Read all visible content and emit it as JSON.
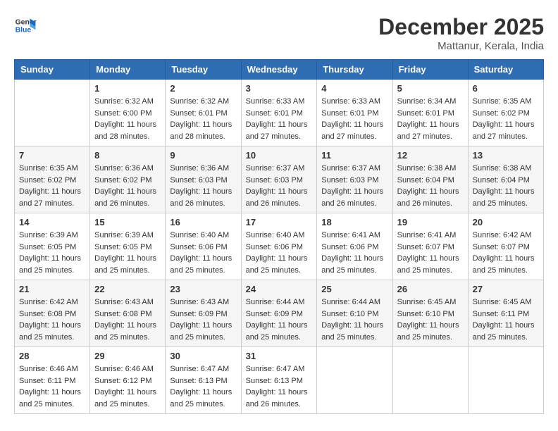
{
  "header": {
    "logo_line1": "General",
    "logo_line2": "Blue",
    "month_title": "December 2025",
    "location": "Mattanur, Kerala, India"
  },
  "weekdays": [
    "Sunday",
    "Monday",
    "Tuesday",
    "Wednesday",
    "Thursday",
    "Friday",
    "Saturday"
  ],
  "weeks": [
    [
      {
        "day": "",
        "info": ""
      },
      {
        "day": "1",
        "info": "Sunrise: 6:32 AM\nSunset: 6:00 PM\nDaylight: 11 hours and 28 minutes."
      },
      {
        "day": "2",
        "info": "Sunrise: 6:32 AM\nSunset: 6:01 PM\nDaylight: 11 hours and 28 minutes."
      },
      {
        "day": "3",
        "info": "Sunrise: 6:33 AM\nSunset: 6:01 PM\nDaylight: 11 hours and 27 minutes."
      },
      {
        "day": "4",
        "info": "Sunrise: 6:33 AM\nSunset: 6:01 PM\nDaylight: 11 hours and 27 minutes."
      },
      {
        "day": "5",
        "info": "Sunrise: 6:34 AM\nSunset: 6:01 PM\nDaylight: 11 hours and 27 minutes."
      },
      {
        "day": "6",
        "info": "Sunrise: 6:35 AM\nSunset: 6:02 PM\nDaylight: 11 hours and 27 minutes."
      }
    ],
    [
      {
        "day": "7",
        "info": "Sunrise: 6:35 AM\nSunset: 6:02 PM\nDaylight: 11 hours and 27 minutes."
      },
      {
        "day": "8",
        "info": "Sunrise: 6:36 AM\nSunset: 6:02 PM\nDaylight: 11 hours and 26 minutes."
      },
      {
        "day": "9",
        "info": "Sunrise: 6:36 AM\nSunset: 6:03 PM\nDaylight: 11 hours and 26 minutes."
      },
      {
        "day": "10",
        "info": "Sunrise: 6:37 AM\nSunset: 6:03 PM\nDaylight: 11 hours and 26 minutes."
      },
      {
        "day": "11",
        "info": "Sunrise: 6:37 AM\nSunset: 6:03 PM\nDaylight: 11 hours and 26 minutes."
      },
      {
        "day": "12",
        "info": "Sunrise: 6:38 AM\nSunset: 6:04 PM\nDaylight: 11 hours and 26 minutes."
      },
      {
        "day": "13",
        "info": "Sunrise: 6:38 AM\nSunset: 6:04 PM\nDaylight: 11 hours and 25 minutes."
      }
    ],
    [
      {
        "day": "14",
        "info": "Sunrise: 6:39 AM\nSunset: 6:05 PM\nDaylight: 11 hours and 25 minutes."
      },
      {
        "day": "15",
        "info": "Sunrise: 6:39 AM\nSunset: 6:05 PM\nDaylight: 11 hours and 25 minutes."
      },
      {
        "day": "16",
        "info": "Sunrise: 6:40 AM\nSunset: 6:06 PM\nDaylight: 11 hours and 25 minutes."
      },
      {
        "day": "17",
        "info": "Sunrise: 6:40 AM\nSunset: 6:06 PM\nDaylight: 11 hours and 25 minutes."
      },
      {
        "day": "18",
        "info": "Sunrise: 6:41 AM\nSunset: 6:06 PM\nDaylight: 11 hours and 25 minutes."
      },
      {
        "day": "19",
        "info": "Sunrise: 6:41 AM\nSunset: 6:07 PM\nDaylight: 11 hours and 25 minutes."
      },
      {
        "day": "20",
        "info": "Sunrise: 6:42 AM\nSunset: 6:07 PM\nDaylight: 11 hours and 25 minutes."
      }
    ],
    [
      {
        "day": "21",
        "info": "Sunrise: 6:42 AM\nSunset: 6:08 PM\nDaylight: 11 hours and 25 minutes."
      },
      {
        "day": "22",
        "info": "Sunrise: 6:43 AM\nSunset: 6:08 PM\nDaylight: 11 hours and 25 minutes."
      },
      {
        "day": "23",
        "info": "Sunrise: 6:43 AM\nSunset: 6:09 PM\nDaylight: 11 hours and 25 minutes."
      },
      {
        "day": "24",
        "info": "Sunrise: 6:44 AM\nSunset: 6:09 PM\nDaylight: 11 hours and 25 minutes."
      },
      {
        "day": "25",
        "info": "Sunrise: 6:44 AM\nSunset: 6:10 PM\nDaylight: 11 hours and 25 minutes."
      },
      {
        "day": "26",
        "info": "Sunrise: 6:45 AM\nSunset: 6:10 PM\nDaylight: 11 hours and 25 minutes."
      },
      {
        "day": "27",
        "info": "Sunrise: 6:45 AM\nSunset: 6:11 PM\nDaylight: 11 hours and 25 minutes."
      }
    ],
    [
      {
        "day": "28",
        "info": "Sunrise: 6:46 AM\nSunset: 6:11 PM\nDaylight: 11 hours and 25 minutes."
      },
      {
        "day": "29",
        "info": "Sunrise: 6:46 AM\nSunset: 6:12 PM\nDaylight: 11 hours and 25 minutes."
      },
      {
        "day": "30",
        "info": "Sunrise: 6:47 AM\nSunset: 6:13 PM\nDaylight: 11 hours and 25 minutes."
      },
      {
        "day": "31",
        "info": "Sunrise: 6:47 AM\nSunset: 6:13 PM\nDaylight: 11 hours and 26 minutes."
      },
      {
        "day": "",
        "info": ""
      },
      {
        "day": "",
        "info": ""
      },
      {
        "day": "",
        "info": ""
      }
    ]
  ]
}
